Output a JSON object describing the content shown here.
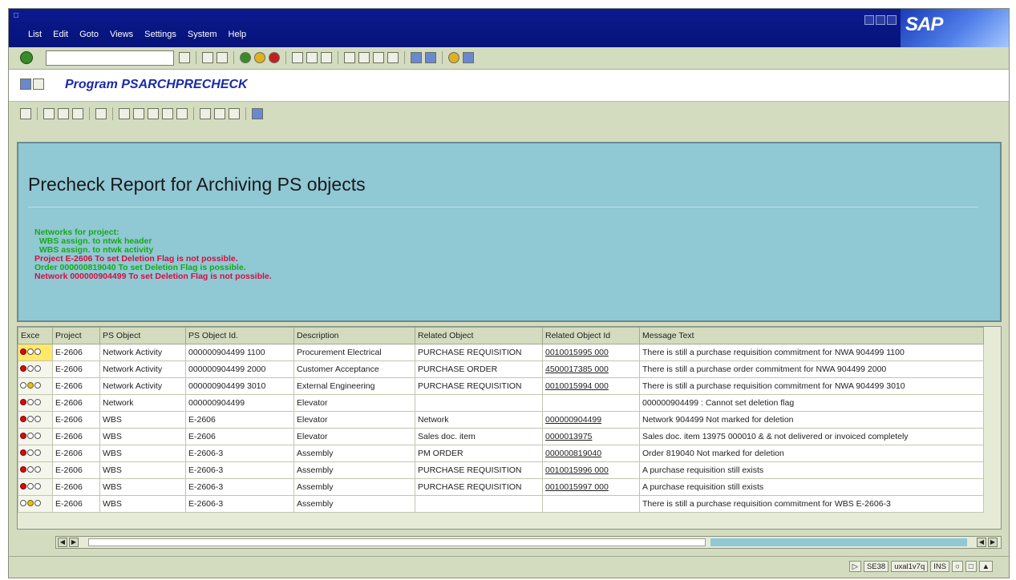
{
  "menubar": {
    "items": [
      "List",
      "Edit",
      "Goto",
      "Views",
      "Settings",
      "System",
      "Help"
    ],
    "logo": "SAP"
  },
  "toolbar": {
    "command_value": ""
  },
  "titlebar": {
    "title": "Program PSARCHPRECHECK"
  },
  "report": {
    "heading": "Precheck Report for Archiving PS objects",
    "messages": [
      {
        "text": "Networks for project:",
        "color": "green"
      },
      {
        "text": "  WBS assign. to ntwk header",
        "color": "green"
      },
      {
        "text": "  WBS assign. to ntwk activity",
        "color": "green"
      },
      {
        "text": "Project E-2606 To set Deletion Flag is not possible.",
        "color": "red"
      },
      {
        "text": "Order 000000819040 To set Deletion Flag is possible.",
        "color": "green"
      },
      {
        "text": "Network 000000904499 To set Deletion Flag is not possible.",
        "color": "red"
      }
    ]
  },
  "grid": {
    "columns": [
      "Exce",
      "Project",
      "PS Object",
      "PS Object Id.",
      "Description",
      "Related Object",
      "Related Object Id",
      "Message Text"
    ],
    "rows": [
      {
        "light": "red",
        "project": "E-2606",
        "ps_object": "Network Activity",
        "ps_object_id": "000000904499 1100",
        "description": "Procurement Electrical",
        "related_object": "PURCHASE REQUISITION",
        "related_object_id": "0010015995 000",
        "message": "There is still a purchase requisition commitment for NWA 904499 1100"
      },
      {
        "light": "red",
        "project": "E-2606",
        "ps_object": "Network Activity",
        "ps_object_id": "000000904499 2000",
        "description": "Customer Acceptance",
        "related_object": "PURCHASE ORDER",
        "related_object_id": "4500017385 000",
        "message": "There is still a purchase order commitment for NWA 904499 2000"
      },
      {
        "light": "yellow",
        "project": "E-2606",
        "ps_object": "Network Activity",
        "ps_object_id": "000000904499 3010",
        "description": "External Engineering",
        "related_object": "PURCHASE REQUISITION",
        "related_object_id": "0010015994 000",
        "message": "There is still a purchase requisition commitment for NWA 904499 3010"
      },
      {
        "light": "red",
        "project": "E-2606",
        "ps_object": "Network",
        "ps_object_id": "000000904499",
        "description": "Elevator",
        "related_object": "",
        "related_object_id": "",
        "message": "000000904499 : Cannot set deletion flag"
      },
      {
        "light": "red",
        "project": "E-2606",
        "ps_object": "WBS",
        "ps_object_id": "E-2606",
        "description": "Elevator",
        "related_object": "Network",
        "related_object_id": "000000904499",
        "message": "Network 904499 Not marked for deletion"
      },
      {
        "light": "red",
        "project": "E-2606",
        "ps_object": "WBS",
        "ps_object_id": "E-2606",
        "description": "Elevator",
        "related_object": "Sales doc. item",
        "related_object_id": "0000013975",
        "message": "Sales doc. item 13975 000010 & & not delivered or invoiced completely"
      },
      {
        "light": "red",
        "project": "E-2606",
        "ps_object": "WBS",
        "ps_object_id": "E-2606-3",
        "description": "Assembly",
        "related_object": "PM ORDER",
        "related_object_id": "000000819040",
        "message": "Order 819040 Not marked for deletion"
      },
      {
        "light": "red",
        "project": "E-2606",
        "ps_object": "WBS",
        "ps_object_id": "E-2606-3",
        "description": "Assembly",
        "related_object": "PURCHASE REQUISITION",
        "related_object_id": "0010015996 000",
        "message": "A purchase requisition still exists"
      },
      {
        "light": "red",
        "project": "E-2606",
        "ps_object": "WBS",
        "ps_object_id": "E-2606-3",
        "description": "Assembly",
        "related_object": "PURCHASE REQUISITION",
        "related_object_id": "0010015997 000",
        "message": "A purchase requisition still exists"
      },
      {
        "light": "yellow",
        "project": "E-2606",
        "ps_object": "WBS",
        "ps_object_id": "E-2606-3",
        "description": "Assembly",
        "related_object": "",
        "related_object_id": "",
        "message": "There is still a purchase requisition commitment for WBS E-2606-3"
      }
    ]
  },
  "statusbar": {
    "transaction": "SE38",
    "user": "uxal1v7q",
    "mode": "INS"
  },
  "colors": {
    "report_bg": "#90c8d4",
    "menubar_bg": "#0b1a8e",
    "title_text": "#1a2aa8",
    "msg_green": "#18a818",
    "msg_red": "#d01040"
  }
}
